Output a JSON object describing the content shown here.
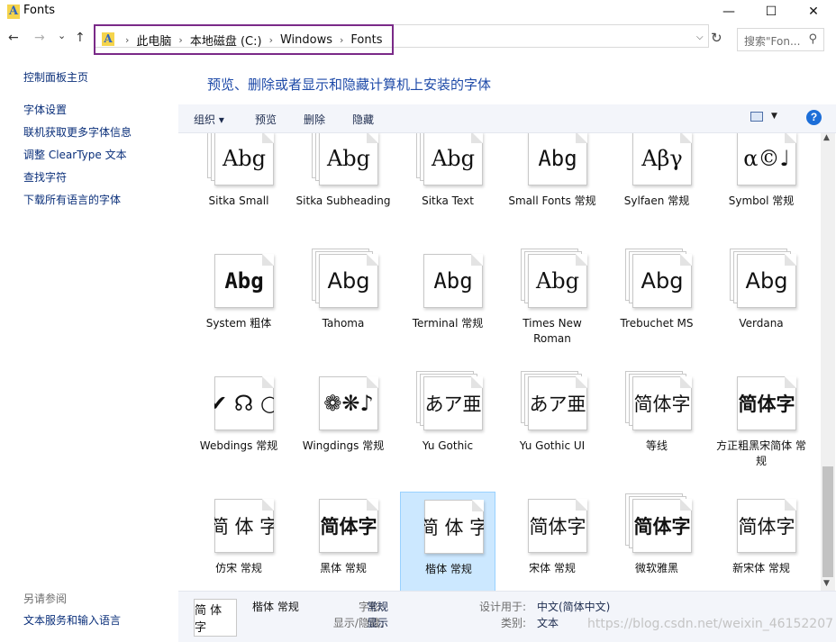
{
  "window": {
    "title": "Fonts",
    "controls": {
      "minimize": "—",
      "maximize": "☐",
      "close": "✕"
    }
  },
  "nav": {
    "back": "←",
    "forward": "→",
    "recent": "⌄",
    "up": "↑",
    "breadcrumbs": [
      "此电脑",
      "本地磁盘 (C:)",
      "Windows",
      "Fonts"
    ],
    "separator": "›",
    "refresh_icon": "↻",
    "search_placeholder": "搜索\"Fon...",
    "search_icon": "⚲"
  },
  "left_pane": {
    "home": "控制面板主页",
    "links": [
      "字体设置",
      "联机获取更多字体信息",
      "调整 ClearType 文本",
      "查找字符",
      "下载所有语言的字体"
    ],
    "see_also_label": "另请参阅",
    "see_also_links": [
      "文本服务和输入语言"
    ]
  },
  "heading": "预览、删除或者显示和隐藏计算机上安装的字体",
  "toolbar": {
    "organize": "组织 ▾",
    "preview": "预览",
    "delete": "删除",
    "hide": "隐藏",
    "view_dd": "▼",
    "help": "?"
  },
  "tiles": [
    {
      "label": "Sitka Small",
      "sample": "Abg",
      "family": "serif",
      "stacked": true
    },
    {
      "label": "Sitka Subheading",
      "sample": "Abg",
      "family": "serif",
      "stacked": true
    },
    {
      "label": "Sitka Text",
      "sample": "Abg",
      "family": "serif",
      "stacked": true
    },
    {
      "label": "Small Fonts 常规",
      "sample": "Abg",
      "family": "mono",
      "stacked": false
    },
    {
      "label": "Sylfaen 常规",
      "sample": "Aβγ",
      "family": "serif",
      "stacked": false
    },
    {
      "label": "Symbol 常规",
      "sample": "α©♩",
      "family": "serif",
      "stacked": false
    },
    {
      "label": "System 粗体",
      "sample": "Abg",
      "family": "monobold",
      "stacked": false
    },
    {
      "label": "Tahoma",
      "sample": "Abg",
      "family": "sans",
      "stacked": true
    },
    {
      "label": "Terminal 常规",
      "sample": "Abg",
      "family": "mono",
      "stacked": false
    },
    {
      "label": "Times New Roman",
      "sample": "Abg",
      "family": "serif",
      "stacked": true
    },
    {
      "label": "Trebuchet MS",
      "sample": "Abg",
      "family": "sans",
      "stacked": true
    },
    {
      "label": "Verdana",
      "sample": "Abg",
      "family": "sans",
      "stacked": true
    },
    {
      "label": "Webdings 常规",
      "sample": "✔ ☊ ○",
      "family": "sans",
      "stacked": false
    },
    {
      "label": "Wingdings 常规",
      "sample": "❁❋♪",
      "family": "sans",
      "stacked": false
    },
    {
      "label": "Yu Gothic",
      "sample": "あア亜",
      "family": "sans",
      "stacked": true
    },
    {
      "label": "Yu Gothic UI",
      "sample": "あア亜",
      "family": "sans",
      "stacked": true
    },
    {
      "label": "等线",
      "sample": "简体字",
      "family": "sans",
      "stacked": true
    },
    {
      "label": "方正粗黑宋简体 常规",
      "sample": "简体字",
      "family": "sansbold",
      "stacked": false
    },
    {
      "label": "仿宋 常规",
      "sample": "简 体 字",
      "family": "serif",
      "stacked": false
    },
    {
      "label": "黑体 常规",
      "sample": "简体字",
      "family": "sansbold",
      "stacked": false
    },
    {
      "label": "楷体 常规",
      "sample": "简 体 字",
      "family": "serif",
      "stacked": false,
      "selected": true
    },
    {
      "label": "宋体 常规",
      "sample": "简体字",
      "family": "serif",
      "stacked": false
    },
    {
      "label": "微软雅黑",
      "sample": "简体字",
      "family": "sansbold",
      "stacked": true
    },
    {
      "label": "新宋体 常规",
      "sample": "简体字",
      "family": "serif",
      "stacked": false
    }
  ],
  "details": {
    "thumb_sample": "简 体 字",
    "name": "楷体 常规",
    "style_key": "字形:",
    "style_val": "常规",
    "show_key": "显示/隐藏:",
    "show_val": "显示",
    "designed_key": "设计用于:",
    "designed_val": "中文(简体中文)",
    "category_key": "类别:",
    "category_val": "文本"
  },
  "watermark": "https://blog.csdn.net/weixin_46152207",
  "colors": {
    "accent_link": "#1e4aa8",
    "selection": "#cce8ff",
    "highlight_box": "#7a2a88"
  }
}
